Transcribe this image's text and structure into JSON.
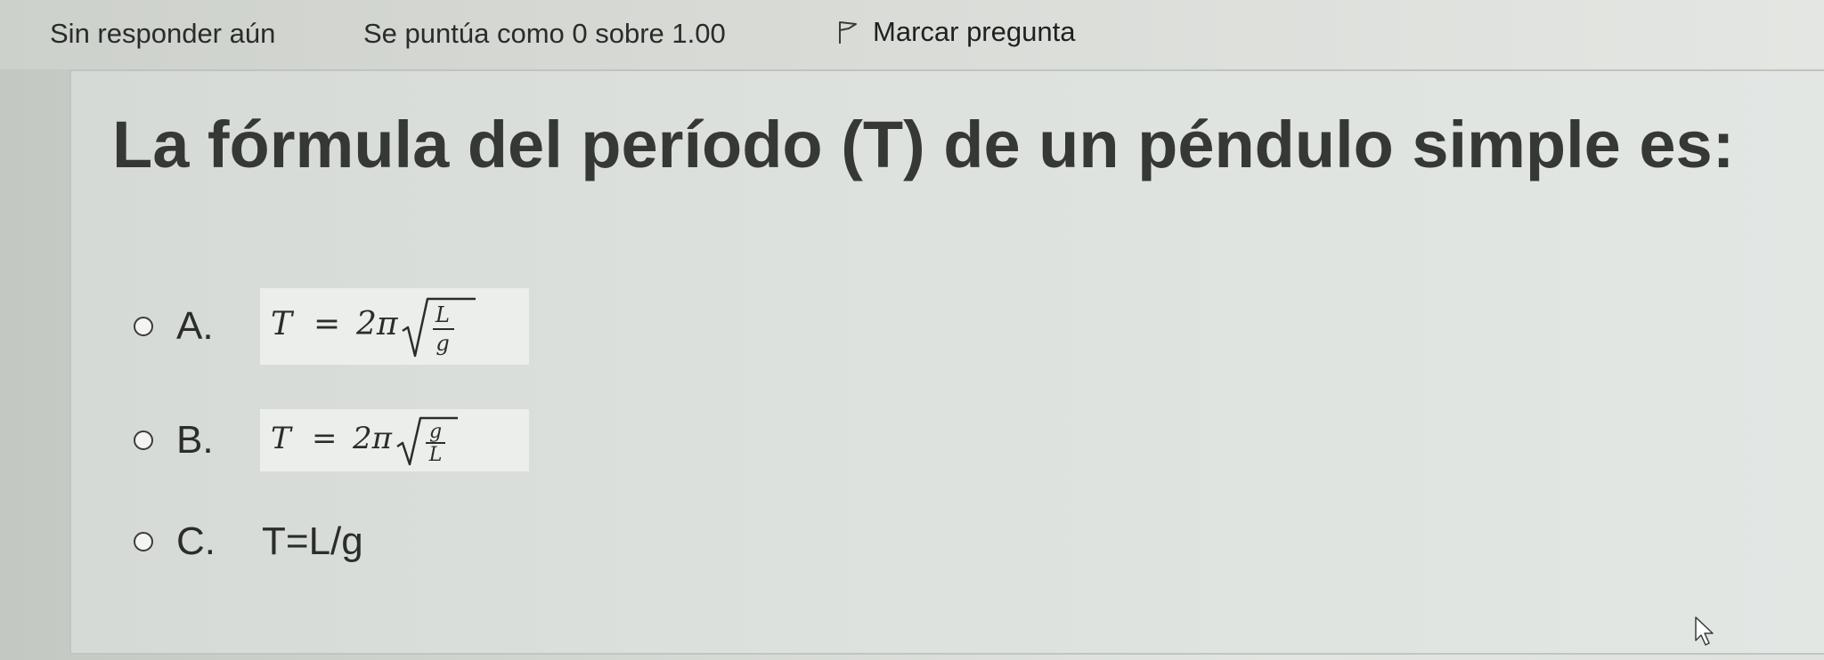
{
  "header": {
    "status": "Sin responder aún",
    "grade": "Se puntúa como 0 sobre 1.00",
    "flag_label": "Marcar pregunta",
    "flag_icon": "flag-icon"
  },
  "question": {
    "text": "La fórmula del período (T) de un péndulo simple es:",
    "options": [
      {
        "letter": "A.",
        "formula": {
          "lhs": "T",
          "eq": "=",
          "coef": "2π",
          "num": "L",
          "den": "g"
        }
      },
      {
        "letter": "B.",
        "formula": {
          "lhs": "T",
          "eq": "=",
          "coef": "2π",
          "num": "g",
          "den": "L"
        }
      },
      {
        "letter": "C.",
        "text": "T=L/g"
      }
    ]
  },
  "colors": {
    "background": "#dde1dd",
    "text": "#2b2d2c",
    "formula_card": "#eceeeb"
  }
}
